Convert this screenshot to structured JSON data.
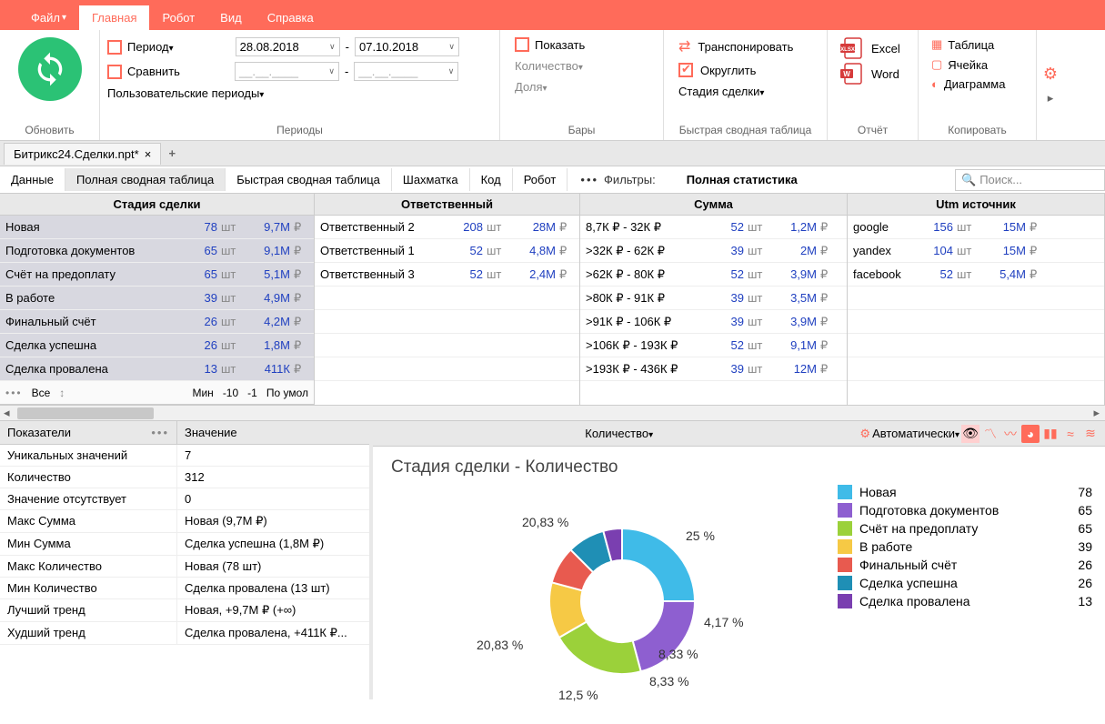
{
  "menu": {
    "file": "Файл",
    "main": "Главная",
    "robot": "Робот",
    "view": "Вид",
    "help": "Справка"
  },
  "ribbon": {
    "refresh": "Обновить",
    "period_label": "Период",
    "compare_label": "Сравнить",
    "date_from": "28.08.2018",
    "date_to": "07.10.2018",
    "date_placeholder": "__.__.____",
    "user_periods": "Пользовательские периоды",
    "periods_group": "Периоды",
    "show": "Показать",
    "quantity": "Количество",
    "share": "Доля",
    "bars_group": "Бары",
    "transpose": "Транспонировать",
    "round": "Округлить",
    "stage": "Стадия сделки",
    "pivot_group": "Быстрая сводная таблица",
    "excel": "Excel",
    "word": "Word",
    "report_group": "Отчёт",
    "table": "Таблица",
    "cell": "Ячейка",
    "diagram": "Диаграмма",
    "copy_group": "Копировать"
  },
  "doc_tab": "Битрикс24.Сделки.npt*",
  "subtabs": {
    "data": "Данные",
    "full_pivot": "Полная сводная таблица",
    "quick_pivot": "Быстрая сводная таблица",
    "chess": "Шахматка",
    "code": "Код",
    "robot": "Робот"
  },
  "filters_label": "Фильтры:",
  "full_stats": "Полная статистика",
  "search_placeholder": "Поиск...",
  "columns": {
    "stage": "Стадия сделки",
    "resp": "Ответственный",
    "sum": "Сумма",
    "utm": "Utm источник"
  },
  "unit_pcs": "шт",
  "currency": "₽",
  "stage_rows": [
    {
      "label": "Новая",
      "count": "78",
      "val": "9,7М"
    },
    {
      "label": "Подготовка документов",
      "count": "65",
      "val": "9,1М"
    },
    {
      "label": "Счёт на предоплату",
      "count": "65",
      "val": "5,1М"
    },
    {
      "label": "В работе",
      "count": "39",
      "val": "4,9М"
    },
    {
      "label": "Финальный счёт",
      "count": "26",
      "val": "4,2М"
    },
    {
      "label": "Сделка успешна",
      "count": "26",
      "val": "1,8М"
    },
    {
      "label": "Сделка провалена",
      "count": "13",
      "val": "411К"
    }
  ],
  "resp_rows": [
    {
      "label": "Ответственный 2",
      "count": "208",
      "val": "28М"
    },
    {
      "label": "Ответственный 1",
      "count": "52",
      "val": "4,8М"
    },
    {
      "label": "Ответственный 3",
      "count": "52",
      "val": "2,4М"
    }
  ],
  "sum_rows": [
    {
      "label": "8,7К ₽ - 32К ₽",
      "count": "52",
      "val": "1,2М"
    },
    {
      "label": ">32К ₽ - 62К ₽",
      "count": "39",
      "val": "2М"
    },
    {
      "label": ">62К ₽ - 80К ₽",
      "count": "52",
      "val": "3,9М"
    },
    {
      "label": ">80К ₽ - 91К ₽",
      "count": "39",
      "val": "3,5М"
    },
    {
      "label": ">91К ₽ - 106К ₽",
      "count": "39",
      "val": "3,9М"
    },
    {
      "label": ">106К ₽ - 193К ₽",
      "count": "52",
      "val": "9,1М"
    },
    {
      "label": ">193К ₽ - 436К ₽",
      "count": "39",
      "val": "12М"
    }
  ],
  "utm_rows": [
    {
      "label": "google",
      "count": "156",
      "val": "15М"
    },
    {
      "label": "yandex",
      "count": "104",
      "val": "15М"
    },
    {
      "label": "facebook",
      "count": "52",
      "val": "5,4М"
    }
  ],
  "controls": {
    "all": "Все",
    "min": "Мин",
    "m10": "-10",
    "m1": "-1",
    "default": "По умол"
  },
  "indicators": {
    "header_k": "Показатели",
    "header_v": "Значение",
    "rows": [
      {
        "k": "Уникальных значений",
        "v": "7"
      },
      {
        "k": "Количество",
        "v": "312"
      },
      {
        "k": "Значение отсутствует",
        "v": "0"
      },
      {
        "k": "Макс Сумма",
        "v": "Новая (9,7М  ₽)"
      },
      {
        "k": "Мин Сумма",
        "v": "Сделка успешна (1,8М  ₽)"
      },
      {
        "k": "Макс Количество",
        "v": "Новая (78  шт)"
      },
      {
        "k": "Мин Количество",
        "v": "Сделка провалена (13  шт)"
      },
      {
        "k": "Лучший тренд",
        "v": "Новая, +9,7М ₽ (+∞)"
      },
      {
        "k": "Худший тренд",
        "v": "Сделка провалена, +411К ₽..."
      }
    ]
  },
  "chart_header": {
    "measure": "Количество",
    "auto": "Автоматически"
  },
  "chart_data": {
    "type": "pie",
    "title": "Стадия сделки - Количество",
    "series": [
      {
        "name": "Новая",
        "value": 78,
        "pct": "25 %",
        "color": "#3fbbe8"
      },
      {
        "name": "Подготовка документов",
        "value": 65,
        "pct": "20,83 %",
        "color": "#8e5fd0"
      },
      {
        "name": "Счёт на предоплату",
        "value": 65,
        "pct": "20,83 %",
        "color": "#9bd13a"
      },
      {
        "name": "В работе",
        "value": 39,
        "pct": "12,5 %",
        "color": "#f6c945"
      },
      {
        "name": "Финальный счёт",
        "value": 26,
        "pct": "8,33 %",
        "color": "#e85a4f"
      },
      {
        "name": "Сделка успешна",
        "value": 26,
        "pct": "8,33 %",
        "color": "#1f8fb5"
      },
      {
        "name": "Сделка провалена",
        "value": 13,
        "pct": "4,17 %",
        "color": "#7a3fb0"
      }
    ]
  }
}
